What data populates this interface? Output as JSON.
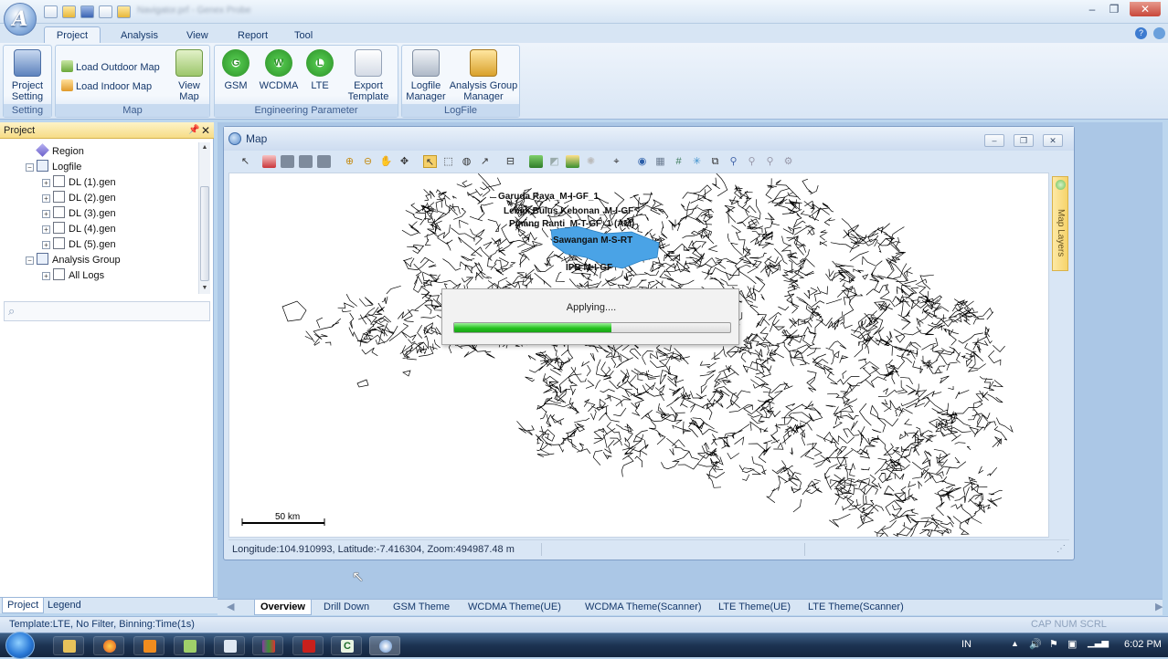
{
  "window": {
    "title_blurred": "Navigator.prf - Genex Probe"
  },
  "ribbon": {
    "tabs": [
      "Project",
      "Analysis",
      "View",
      "Report",
      "Tool"
    ],
    "active_tab": "Project",
    "groups": {
      "setting": {
        "title": "Setting",
        "project_setting": "Project\nSetting"
      },
      "map": {
        "title": "Map",
        "load_outdoor": "Load Outdoor Map",
        "load_indoor": "Load Indoor Map",
        "view_map": "View\nMap"
      },
      "engineering": {
        "title": "Engineering Parameter",
        "gsm": "GSM",
        "wcdma": "WCDMA",
        "lte": "LTE",
        "export_template": "Export\nTemplate"
      },
      "logfile": {
        "title": "LogFile",
        "logfile_manager": "Logfile\nManager",
        "analysis_group_manager": "Analysis Group\nManager"
      }
    }
  },
  "project_panel": {
    "title": "Project",
    "tree": [
      {
        "label": "Region",
        "level": 1,
        "expander": ""
      },
      {
        "label": "Logfile",
        "level": 1,
        "expander": "−"
      },
      {
        "label": "DL (1).gen",
        "level": 2,
        "expander": "+"
      },
      {
        "label": "DL (2).gen",
        "level": 2,
        "expander": "+"
      },
      {
        "label": "DL (3).gen",
        "level": 2,
        "expander": "+"
      },
      {
        "label": "DL (4).gen",
        "level": 2,
        "expander": "+"
      },
      {
        "label": "DL (5).gen",
        "level": 2,
        "expander": "+"
      },
      {
        "label": "Analysis Group",
        "level": 1,
        "expander": "−"
      },
      {
        "label": "All Logs",
        "level": 2,
        "expander": "+"
      }
    ],
    "search_placeholder": "",
    "bottom_tabs": [
      "Project",
      "Legend"
    ]
  },
  "map_window": {
    "title": "Map",
    "map_layers_tab": "Map Layers",
    "site_labels": [
      "Garuda Raya_M-I-GF_1",
      "Lebak Bulus Kebonan_M-I-GF",
      "Pinang Ranti_M-T-GF_1 (AM)",
      "Sawangan M-S-RT",
      "IPB M-I-GF"
    ],
    "scale_label": "50 km",
    "status_text": "Longitude:104.910993, Latitude:-7.416304, Zoom:494987.48 m",
    "progress": {
      "label": "Applying....",
      "percent": 57
    }
  },
  "doc_tabs": [
    "Overview",
    "Drill Down",
    "GSM Theme",
    "WCDMA Theme(UE)",
    "WCDMA Theme(Scanner)",
    "LTE Theme(UE)",
    "LTE Theme(Scanner)"
  ],
  "active_doc_tab": "Overview",
  "statusbar": {
    "left": "Template:LTE,  No Filter,  Binning:Time(1s)",
    "indicators": "CAP  NUM  SCRL"
  },
  "taskbar": {
    "lang": "IN",
    "clock": "6:02 PM"
  },
  "colors": {
    "ribbon_bg": "#d7e5f4",
    "accent": "#15386b",
    "progress": "#23c21e",
    "site_blob": "#4aa3e6"
  }
}
